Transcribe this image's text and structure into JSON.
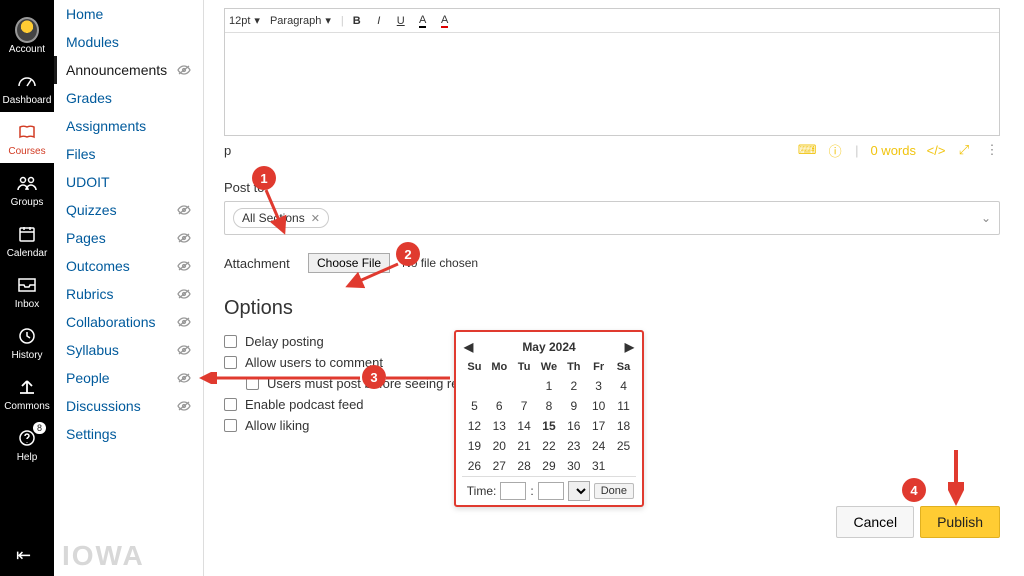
{
  "global_nav": [
    {
      "id": "account",
      "label": "Account"
    },
    {
      "id": "dashboard",
      "label": "Dashboard"
    },
    {
      "id": "courses",
      "label": "Courses"
    },
    {
      "id": "groups",
      "label": "Groups"
    },
    {
      "id": "calendar",
      "label": "Calendar"
    },
    {
      "id": "inbox",
      "label": "Inbox"
    },
    {
      "id": "history",
      "label": "History"
    },
    {
      "id": "commons",
      "label": "Commons"
    },
    {
      "id": "help",
      "label": "Help",
      "badge": "8"
    }
  ],
  "course_nav": [
    {
      "label": "Home",
      "hidden": false
    },
    {
      "label": "Modules",
      "hidden": false
    },
    {
      "label": "Announcements",
      "hidden": true,
      "active": true
    },
    {
      "label": "Grades",
      "hidden": false
    },
    {
      "label": "Assignments",
      "hidden": false
    },
    {
      "label": "Files",
      "hidden": false
    },
    {
      "label": "UDOIT",
      "hidden": false
    },
    {
      "label": "Quizzes",
      "hidden": true
    },
    {
      "label": "Pages",
      "hidden": true
    },
    {
      "label": "Outcomes",
      "hidden": true
    },
    {
      "label": "Rubrics",
      "hidden": true
    },
    {
      "label": "Collaborations",
      "hidden": true
    },
    {
      "label": "Syllabus",
      "hidden": true
    },
    {
      "label": "People",
      "hidden": true
    },
    {
      "label": "Discussions",
      "hidden": true
    },
    {
      "label": "Settings",
      "hidden": false
    }
  ],
  "toolbar": {
    "font_size": "12pt",
    "style": "Paragraph"
  },
  "status": {
    "path": "p",
    "words": "0 words",
    "html": "</>"
  },
  "post_to": {
    "label": "Post to",
    "chip": "All Sections"
  },
  "attachment": {
    "label": "Attachment",
    "button": "Choose File",
    "empty": "No file chosen"
  },
  "options": {
    "heading": "Options",
    "delay": "Delay posting",
    "comment": "Allow users to comment",
    "mustpost": "Users must post before seeing replies",
    "podcast": "Enable podcast feed",
    "liking": "Allow liking"
  },
  "calendar": {
    "month": "May 2024",
    "dow": [
      "Su",
      "Mo",
      "Tu",
      "We",
      "Th",
      "Fr",
      "Sa"
    ],
    "weeks": [
      [
        "",
        "",
        "",
        "1",
        "2",
        "3",
        "4"
      ],
      [
        "5",
        "6",
        "7",
        "8",
        "9",
        "10",
        "11"
      ],
      [
        "12",
        "13",
        "14",
        "15",
        "16",
        "17",
        "18"
      ],
      [
        "19",
        "20",
        "21",
        "22",
        "23",
        "24",
        "25"
      ],
      [
        "26",
        "27",
        "28",
        "29",
        "30",
        "31",
        ""
      ]
    ],
    "today": "15",
    "time_label": "Time:",
    "done": "Done"
  },
  "buttons": {
    "cancel": "Cancel",
    "publish": "Publish"
  },
  "watermark": "IOWA",
  "callouts": {
    "c1": "1",
    "c2": "2",
    "c3": "3",
    "c4": "4"
  }
}
